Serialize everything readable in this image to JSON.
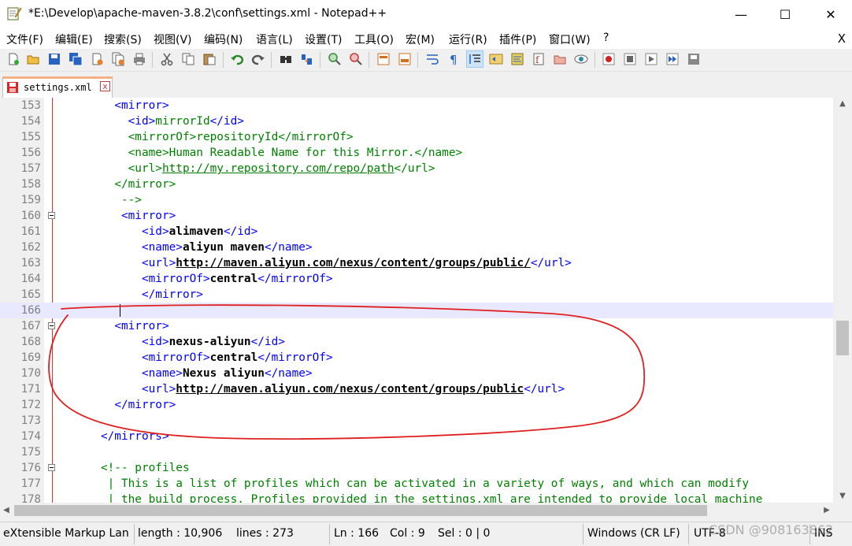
{
  "window": {
    "title": "*E:\\Develop\\apache-maven-3.8.2\\conf\\settings.xml - Notepad++",
    "minimize": "—",
    "maximize": "☐",
    "close": "✕"
  },
  "menu": {
    "items": [
      "文件(F)",
      "编辑(E)",
      "搜索(S)",
      "视图(V)",
      "编码(N)",
      "语言(L)",
      "设置(T)",
      "工具(O)",
      "宏(M)",
      "运行(R)",
      "插件(P)",
      "窗口(W)",
      "?"
    ],
    "close": "X"
  },
  "tab": {
    "label": "settings.xml",
    "close": "x"
  },
  "editor": {
    "current_line": "166",
    "lines": [
      {
        "n": "153",
        "fold": false,
        "parts": [
          [
            "        ",
            "t"
          ],
          [
            "<mirror>",
            "t"
          ]
        ]
      },
      {
        "n": "154",
        "fold": false,
        "parts": [
          [
            "          ",
            "t"
          ],
          [
            "<id>",
            "t"
          ],
          [
            "mirrorId",
            "g"
          ],
          [
            "</id>",
            "t"
          ]
        ]
      },
      {
        "n": "155",
        "fold": false,
        "parts": [
          [
            "          ",
            "t"
          ],
          [
            "<mirrorOf>",
            "g"
          ],
          [
            "repositoryId",
            "g"
          ],
          [
            "</mirrorOf>",
            "g"
          ]
        ]
      },
      {
        "n": "156",
        "fold": false,
        "parts": [
          [
            "          ",
            "t"
          ],
          [
            "<name>",
            "g"
          ],
          [
            "Human Readable Name for this Mirror.",
            "g"
          ],
          [
            "</name>",
            "g"
          ]
        ]
      },
      {
        "n": "157",
        "fold": false,
        "parts": [
          [
            "          ",
            "t"
          ],
          [
            "<url>",
            "g"
          ],
          [
            "http://my.repository.com/repo/path",
            "gu"
          ],
          [
            "</url>",
            "g"
          ]
        ]
      },
      {
        "n": "158",
        "fold": false,
        "parts": [
          [
            "        ",
            "t"
          ],
          [
            "</mirror>",
            "g"
          ]
        ]
      },
      {
        "n": "159",
        "fold": false,
        "parts": [
          [
            "         ",
            "t"
          ],
          [
            "-->",
            "g"
          ]
        ]
      },
      {
        "n": "160",
        "fold": true,
        "parts": [
          [
            "         ",
            "t"
          ],
          [
            "<mirror>",
            "t"
          ]
        ]
      },
      {
        "n": "161",
        "fold": false,
        "parts": [
          [
            "            ",
            "t"
          ],
          [
            "<id>",
            "t"
          ],
          [
            "alimaven",
            "b"
          ],
          [
            "</id>",
            "t"
          ]
        ]
      },
      {
        "n": "162",
        "fold": false,
        "parts": [
          [
            "            ",
            "t"
          ],
          [
            "<name>",
            "t"
          ],
          [
            "aliyun maven",
            "b"
          ],
          [
            "</name>",
            "t"
          ]
        ]
      },
      {
        "n": "163",
        "fold": false,
        "parts": [
          [
            "            ",
            "t"
          ],
          [
            "<url>",
            "t"
          ],
          [
            "http://maven.aliyun.com/nexus/content/groups/public/",
            "bu"
          ],
          [
            "</url>",
            "t"
          ]
        ]
      },
      {
        "n": "164",
        "fold": false,
        "parts": [
          [
            "            ",
            "t"
          ],
          [
            "<mirrorOf>",
            "t"
          ],
          [
            "central",
            "b"
          ],
          [
            "</mirrorOf>",
            "t"
          ]
        ]
      },
      {
        "n": "165",
        "fold": false,
        "parts": [
          [
            "            ",
            "t"
          ],
          [
            "</mirror>",
            "t"
          ]
        ]
      },
      {
        "n": "166",
        "fold": false,
        "parts": [
          [
            "",
            "t"
          ]
        ]
      },
      {
        "n": "167",
        "fold": true,
        "parts": [
          [
            "        ",
            "t"
          ],
          [
            "<mirror>",
            "t"
          ]
        ]
      },
      {
        "n": "168",
        "fold": false,
        "parts": [
          [
            "            ",
            "t"
          ],
          [
            "<id>",
            "t"
          ],
          [
            "nexus-aliyun",
            "b"
          ],
          [
            "</id>",
            "t"
          ]
        ]
      },
      {
        "n": "169",
        "fold": false,
        "parts": [
          [
            "            ",
            "t"
          ],
          [
            "<mirrorOf>",
            "t"
          ],
          [
            "central",
            "b"
          ],
          [
            "</mirrorOf>",
            "t"
          ]
        ]
      },
      {
        "n": "170",
        "fold": false,
        "parts": [
          [
            "            ",
            "t"
          ],
          [
            "<name>",
            "t"
          ],
          [
            "Nexus aliyun",
            "b"
          ],
          [
            "</name>",
            "t"
          ]
        ]
      },
      {
        "n": "171",
        "fold": false,
        "parts": [
          [
            "            ",
            "t"
          ],
          [
            "<url>",
            "t"
          ],
          [
            "http://maven.aliyun.com/nexus/content/groups/public",
            "bu"
          ],
          [
            "</url>",
            "t"
          ]
        ]
      },
      {
        "n": "172",
        "fold": false,
        "parts": [
          [
            "        ",
            "t"
          ],
          [
            "</mirror>",
            "t"
          ]
        ]
      },
      {
        "n": "173",
        "fold": false,
        "parts": [
          [
            "",
            "t"
          ]
        ]
      },
      {
        "n": "174",
        "fold": false,
        "parts": [
          [
            "      ",
            "t"
          ],
          [
            "</mirrors>",
            "t"
          ]
        ]
      },
      {
        "n": "175",
        "fold": false,
        "parts": [
          [
            "",
            "t"
          ]
        ]
      },
      {
        "n": "176",
        "fold": true,
        "parts": [
          [
            "      ",
            "t"
          ],
          [
            "<!-- profiles",
            "g"
          ]
        ]
      },
      {
        "n": "177",
        "fold": false,
        "parts": [
          [
            "       ",
            "t"
          ],
          [
            "| This is a list of profiles which can be activated in a variety of ways, and which can modify",
            "g"
          ]
        ]
      },
      {
        "n": "178",
        "fold": false,
        "parts": [
          [
            "       ",
            "t"
          ],
          [
            "| the build process. Profiles provided in the settings.xml are intended to provide local machine",
            "g"
          ]
        ]
      }
    ]
  },
  "status": {
    "language": "eXtensible Markup Lan",
    "length": "length : 10,906",
    "lines": "lines : 273",
    "ln": "Ln : 166",
    "col": "Col : 9",
    "sel": "Sel : 0 | 0",
    "eol": "Windows (CR LF)",
    "encoding": "UTF-8",
    "mode": "INS"
  },
  "watermark": "CSDN @908163862",
  "colors": {
    "annotation": "#e02020",
    "tag": "#0000ff",
    "comment": "#008000",
    "current_line": "#e8e8ff"
  }
}
